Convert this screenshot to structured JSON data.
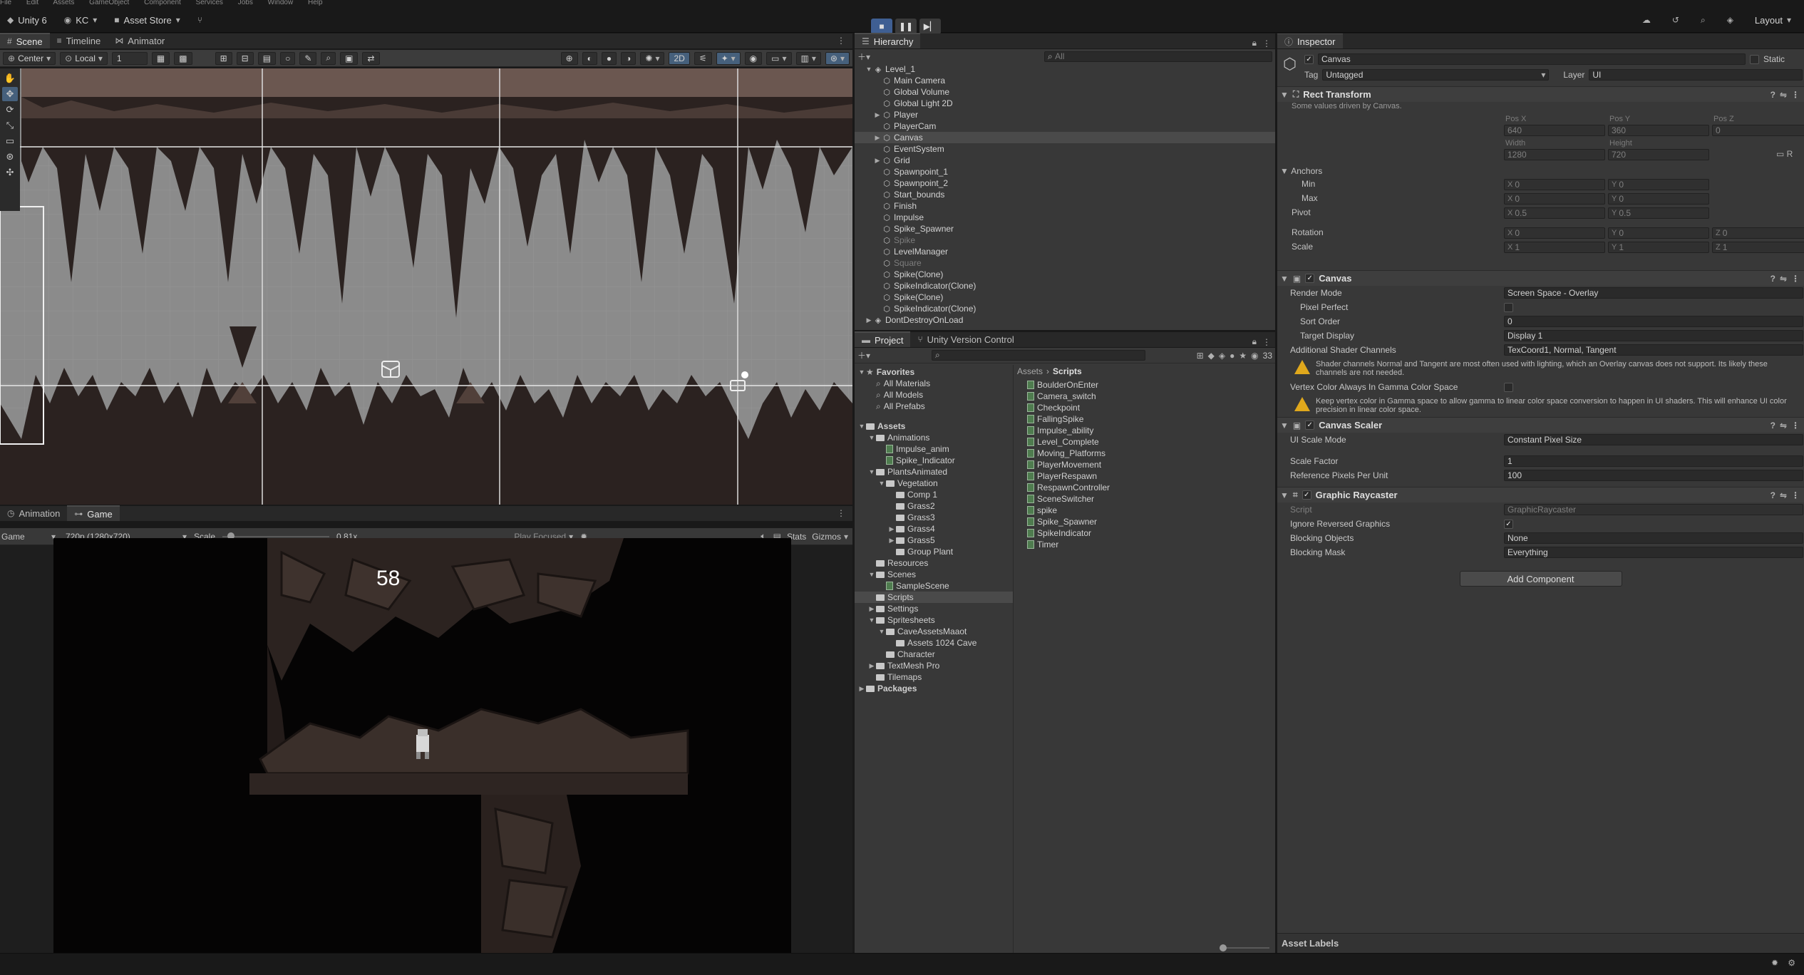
{
  "menu": [
    "File",
    "Edit",
    "Assets",
    "GameObject",
    "Component",
    "Services",
    "Jobs",
    "Window",
    "Help"
  ],
  "toolbar": {
    "app_label": "Unity 6",
    "account": "KC",
    "asset_store": "Asset Store",
    "layout": "Layout"
  },
  "scene_tabs": {
    "scene": "Scene",
    "timeline": "Timeline",
    "animator": "Animator"
  },
  "scene_toolbar": {
    "pivot": "Center",
    "space": "Local",
    "snap_value": "1",
    "mode_2d": "2D"
  },
  "game_tabs": {
    "animation": "Animation",
    "game": "Game"
  },
  "game_toolbar": {
    "display": "Game",
    "resolution": "720p (1280x720)",
    "scale_label": "Scale",
    "scale_value": "0.81x",
    "play_mode": "Play Focused",
    "stats": "Stats",
    "gizmos": "Gizmos",
    "scale_fraction": 0.08
  },
  "game_view": {
    "timer": "58"
  },
  "hierarchy": {
    "title": "Hierarchy",
    "search_placeholder": "All",
    "items": [
      {
        "label": "Level_1",
        "depth": 0,
        "arrow": "▼",
        "kind": "scene"
      },
      {
        "label": "Main Camera",
        "depth": 1,
        "arrow": "",
        "kind": "go"
      },
      {
        "label": "Global Volume",
        "depth": 1,
        "arrow": "",
        "kind": "go"
      },
      {
        "label": "Global Light 2D",
        "depth": 1,
        "arrow": "",
        "kind": "go"
      },
      {
        "label": "Player",
        "depth": 1,
        "arrow": "▶",
        "kind": "go"
      },
      {
        "label": "PlayerCam",
        "depth": 1,
        "arrow": "",
        "kind": "go"
      },
      {
        "label": "Canvas",
        "depth": 1,
        "arrow": "▶",
        "kind": "go",
        "selected": true
      },
      {
        "label": "EventSystem",
        "depth": 1,
        "arrow": "",
        "kind": "go"
      },
      {
        "label": "Grid",
        "depth": 1,
        "arrow": "▶",
        "kind": "go"
      },
      {
        "label": "Spawnpoint_1",
        "depth": 1,
        "arrow": "",
        "kind": "go"
      },
      {
        "label": "Spawnpoint_2",
        "depth": 1,
        "arrow": "",
        "kind": "go"
      },
      {
        "label": "Start_bounds",
        "depth": 1,
        "arrow": "",
        "kind": "go"
      },
      {
        "label": "Finish",
        "depth": 1,
        "arrow": "",
        "kind": "go"
      },
      {
        "label": "Impulse",
        "depth": 1,
        "arrow": "",
        "kind": "go"
      },
      {
        "label": "Spike_Spawner",
        "depth": 1,
        "arrow": "",
        "kind": "go"
      },
      {
        "label": "Spike",
        "depth": 1,
        "arrow": "",
        "kind": "go",
        "dim": true
      },
      {
        "label": "LevelManager",
        "depth": 1,
        "arrow": "",
        "kind": "go"
      },
      {
        "label": "Square",
        "depth": 1,
        "arrow": "",
        "kind": "go",
        "dim": true
      },
      {
        "label": "Spike(Clone)",
        "depth": 1,
        "arrow": "",
        "kind": "go"
      },
      {
        "label": "SpikeIndicator(Clone)",
        "depth": 1,
        "arrow": "",
        "kind": "go"
      },
      {
        "label": "Spike(Clone)",
        "depth": 1,
        "arrow": "",
        "kind": "go"
      },
      {
        "label": "SpikeIndicator(Clone)",
        "depth": 1,
        "arrow": "",
        "kind": "go"
      },
      {
        "label": "DontDestroyOnLoad",
        "depth": 0,
        "arrow": "▶",
        "kind": "scene"
      }
    ]
  },
  "project": {
    "tab_project": "Project",
    "tab_vcs": "Unity Version Control",
    "count": "33",
    "breadcrumb": [
      "Assets",
      "Scripts"
    ],
    "tree": [
      {
        "label": "Favorites",
        "depth": 0,
        "arrow": "▼",
        "bold": true,
        "kind": "star"
      },
      {
        "label": "All Materials",
        "depth": 1,
        "kind": "search"
      },
      {
        "label": "All Models",
        "depth": 1,
        "kind": "search"
      },
      {
        "label": "All Prefabs",
        "depth": 1,
        "kind": "search"
      },
      {
        "label": "",
        "depth": 0,
        "kind": "spacer"
      },
      {
        "label": "Assets",
        "depth": 0,
        "arrow": "▼",
        "bold": true,
        "kind": "folder"
      },
      {
        "label": "Animations",
        "depth": 1,
        "arrow": "▼",
        "kind": "folder"
      },
      {
        "label": "Impulse_anim",
        "depth": 2,
        "kind": "file"
      },
      {
        "label": "Spike_Indicator",
        "depth": 2,
        "kind": "file"
      },
      {
        "label": "PlantsAnimated",
        "depth": 1,
        "arrow": "▼",
        "kind": "folder"
      },
      {
        "label": "Vegetation",
        "depth": 2,
        "arrow": "▼",
        "kind": "folder"
      },
      {
        "label": "Comp 1",
        "depth": 3,
        "kind": "folder"
      },
      {
        "label": "Grass2",
        "depth": 3,
        "kind": "folder"
      },
      {
        "label": "Grass3",
        "depth": 3,
        "kind": "folder"
      },
      {
        "label": "Grass4",
        "depth": 3,
        "arrow": "▶",
        "kind": "folder"
      },
      {
        "label": "Grass5",
        "depth": 3,
        "arrow": "▶",
        "kind": "folder"
      },
      {
        "label": "Group Plant",
        "depth": 3,
        "kind": "folder"
      },
      {
        "label": "Resources",
        "depth": 1,
        "kind": "folder"
      },
      {
        "label": "Scenes",
        "depth": 1,
        "arrow": "▼",
        "kind": "folder"
      },
      {
        "label": "SampleScene",
        "depth": 2,
        "kind": "file"
      },
      {
        "label": "Scripts",
        "depth": 1,
        "kind": "folder",
        "selected": true
      },
      {
        "label": "Settings",
        "depth": 1,
        "arrow": "▶",
        "kind": "folder"
      },
      {
        "label": "Spritesheets",
        "depth": 1,
        "arrow": "▼",
        "kind": "folder"
      },
      {
        "label": "CaveAssetsMaaot",
        "depth": 2,
        "arrow": "▼",
        "kind": "folder"
      },
      {
        "label": "Assets 1024 Cave",
        "depth": 3,
        "kind": "folder"
      },
      {
        "label": "Character",
        "depth": 2,
        "kind": "folder"
      },
      {
        "label": "TextMesh Pro",
        "depth": 1,
        "arrow": "▶",
        "kind": "folder"
      },
      {
        "label": "Tilemaps",
        "depth": 1,
        "kind": "folder"
      },
      {
        "label": "Packages",
        "depth": 0,
        "arrow": "▶",
        "bold": true,
        "kind": "folder"
      }
    ],
    "scripts": [
      "BoulderOnEnter",
      "Camera_switch",
      "Checkpoint",
      "FallingSpike",
      "Impulse_ability",
      "Level_Complete",
      "Moving_Platforms",
      "PlayerMovement",
      "PlayerRespawn",
      "RespawnController",
      "SceneSwitcher",
      "spike",
      "Spike_Spawner",
      "SpikeIndicator",
      "Timer"
    ]
  },
  "inspector": {
    "title": "Inspector",
    "object_name": "Canvas",
    "static_label": "Static",
    "tag_label": "Tag",
    "tag_value": "Untagged",
    "layer_label": "Layer",
    "layer_value": "UI",
    "rect": {
      "title": "Rect Transform",
      "note": "Some values driven by Canvas.",
      "posx_label": "Pos X",
      "posy_label": "Pos Y",
      "posz_label": "Pos Z",
      "posx": "640",
      "posy": "360",
      "posz": "0",
      "width_label": "Width",
      "height_label": "Height",
      "width": "1280",
      "height": "720",
      "anchors_label": "Anchors",
      "min_label": "Min",
      "min_x": "0",
      "min_y": "0",
      "max_label": "Max",
      "max_x": "0",
      "max_y": "0",
      "pivot_label": "Pivot",
      "pivot_x": "0.5",
      "pivot_y": "0.5",
      "rotation_label": "Rotation",
      "rot_x": "0",
      "rot_y": "0",
      "rot_z": "0",
      "scale_label": "Scale",
      "scale_x": "1",
      "scale_y": "1",
      "scale_z": "1"
    },
    "canvas": {
      "title": "Canvas",
      "render_mode_label": "Render Mode",
      "render_mode": "Screen Space - Overlay",
      "pixel_perfect_label": "Pixel Perfect",
      "sort_order_label": "Sort Order",
      "sort_order": "0",
      "target_display_label": "Target Display",
      "target_display": "Display 1",
      "shader_channels_label": "Additional Shader Channels",
      "shader_channels": "TexCoord1, Normal, Tangent",
      "warning1": "Shader channels Normal and Tangent are most often used with lighting, which an Overlay canvas does not support. Its likely these channels are not needed.",
      "vertex_color_label": "Vertex Color Always In Gamma Color Space",
      "warning2": "Keep vertex color in Gamma space to allow gamma to linear color space conversion to happen in UI shaders. This will enhance UI color precision in linear color space."
    },
    "scaler": {
      "title": "Canvas Scaler",
      "ui_scale_label": "UI Scale Mode",
      "ui_scale": "Constant Pixel Size",
      "scale_factor_label": "Scale Factor",
      "scale_factor": "1",
      "ref_ppu_label": "Reference Pixels Per Unit",
      "ref_ppu": "100"
    },
    "raycaster": {
      "title": "Graphic Raycaster",
      "script_label": "Script",
      "script_value": "GraphicRaycaster",
      "ignore_label": "Ignore Reversed Graphics",
      "blocking_objects_label": "Blocking Objects",
      "blocking_objects": "None",
      "blocking_mask_label": "Blocking Mask",
      "blocking_mask": "Everything"
    },
    "add_component": "Add Component",
    "asset_labels": "Asset Labels"
  }
}
